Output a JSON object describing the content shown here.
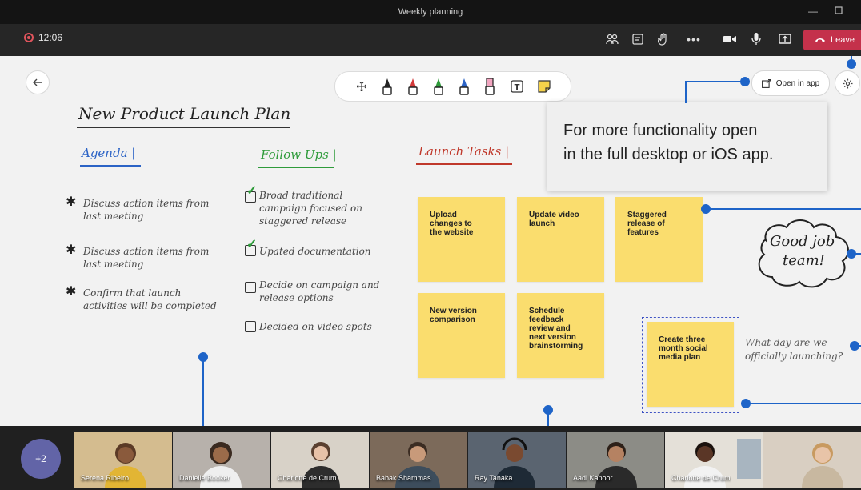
{
  "window": {
    "title": "Weekly planning"
  },
  "topbar": {
    "timer": "12:06",
    "leave_label": "Leave"
  },
  "toolbar": {
    "text_tool_glyph": "T",
    "pen_colors": [
      "#222222",
      "#d33a3a",
      "#2e9b3a",
      "#2b63c6"
    ],
    "highlighter_color": "#f2a5c0",
    "sticky_color": "#f5d24a"
  },
  "whiteboard": {
    "open_in_app_label": "Open in app",
    "tooltip": {
      "line1": "For more functionality open",
      "line2": "in the full desktop or iOS app."
    },
    "title": "New Product Launch Plan",
    "agenda": {
      "heading": "Agenda",
      "items": [
        {
          "l1": "Discuss action items from",
          "l2": "last meeting"
        },
        {
          "l1": "Discuss action items from",
          "l2": "last meeting"
        },
        {
          "l1": "Confirm that launch",
          "l2": "activities will be completed"
        }
      ]
    },
    "followups": {
      "heading": "Follow Ups",
      "items": [
        {
          "l1": "Broad traditional",
          "l2": "campaign focused on",
          "l3": "staggered release",
          "checked": true
        },
        {
          "l1": "Upated documentation",
          "l2": "",
          "l3": "",
          "checked": true
        },
        {
          "l1": "Decide on campaign and",
          "l2": "release options",
          "l3": "",
          "checked": false
        },
        {
          "l1": "Decided on video spots",
          "l2": "",
          "l3": "",
          "checked": false
        }
      ]
    },
    "launch_tasks": {
      "heading": "Launch Tasks",
      "stickies": [
        {
          "l1": "Upload",
          "l2": "changes to",
          "l3": "the website",
          "l4": ""
        },
        {
          "l1": "Update video",
          "l2": "launch",
          "l3": "",
          "l4": ""
        },
        {
          "l1": "Staggered",
          "l2": "release of",
          "l3": "features",
          "l4": ""
        },
        {
          "l1": "New version",
          "l2": "comparison",
          "l3": "",
          "l4": ""
        },
        {
          "l1": "Schedule",
          "l2": "feedback",
          "l3": "review and",
          "l4": "next version",
          "l5": "brainstorming"
        },
        {
          "l1": "Create three",
          "l2": "month social",
          "l3": "media plan",
          "l4": ""
        }
      ]
    },
    "cloud": {
      "l1": "Good job",
      "l2": "team!"
    },
    "question": {
      "l1": "What day are we",
      "l2": "officially launching?"
    },
    "colors": {
      "title_color": "#222222",
      "agenda_color": "#2b63c6",
      "followups_color": "#2e9b3a",
      "launch_color": "#c0392b",
      "callout_color": "#1e64c8"
    }
  },
  "participants": {
    "more_count": "+2",
    "tiles": [
      {
        "name": "Serena Ribeiro",
        "bg": "#c9a86a"
      },
      {
        "name": "Danielle Booker",
        "bg": "#b7b1ab"
      },
      {
        "name": "Charlotte de Crum",
        "bg": "#d8d2c8"
      },
      {
        "name": "Babak Shammas",
        "bg": "#7c6a5a"
      },
      {
        "name": "Ray Tanaka",
        "bg": "#5a6470"
      },
      {
        "name": "Aadi Kapoor",
        "bg": "#8c8c86"
      },
      {
        "name": "Charlotte de Crum",
        "bg": "#e4e0d8"
      },
      {
        "name": "",
        "bg": "#d9cfc2"
      }
    ]
  }
}
